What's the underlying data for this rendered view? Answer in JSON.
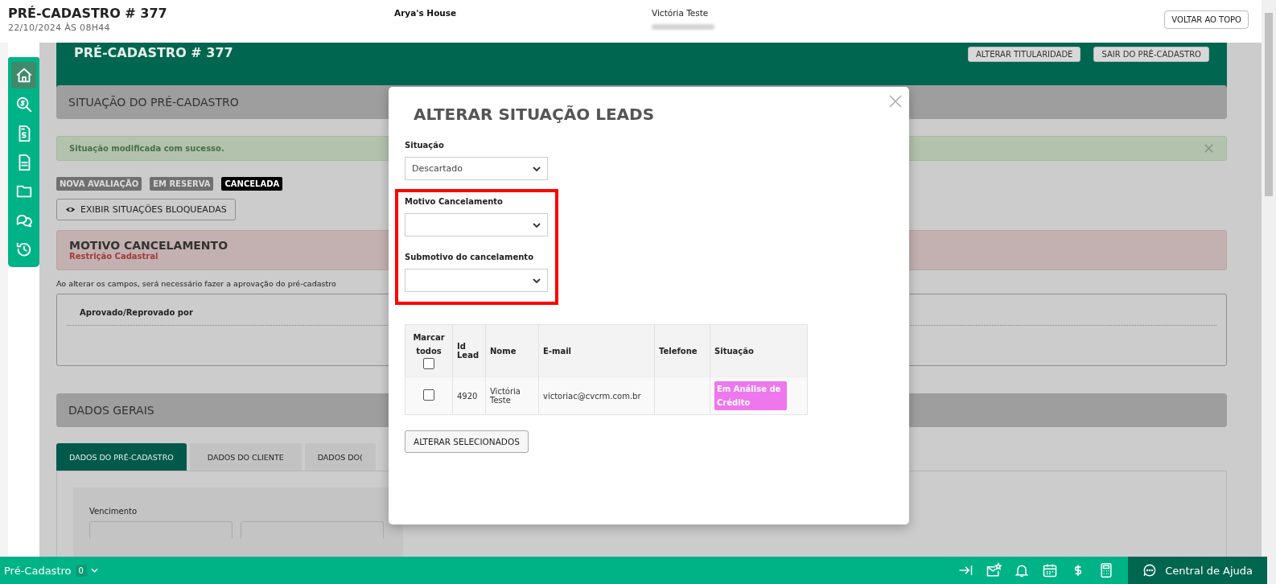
{
  "header": {
    "title": "PRÉ-CADASTRO # 377",
    "date": "22/10/2024 ÀS 08H44",
    "project": "Arya's House",
    "client": "Victória Teste",
    "top_button": "VOLTAR AO TOPO"
  },
  "banner": {
    "title": "PRÉ-CADASTRO # 377",
    "buttons": [
      "ALTERAR TITULARIDADE",
      "SAIR DO PRÉ-CADASTRO"
    ]
  },
  "sidebar": {
    "items": [
      {
        "selected": true
      },
      {
        "selected": false
      },
      {
        "selected": false
      },
      {
        "selected": false
      },
      {
        "selected": false
      },
      {
        "selected": false
      },
      {
        "selected": false
      }
    ]
  },
  "situation_section": {
    "title": "SITUAÇÃO DO PRÉ-CADASTRO",
    "alert": "Situação modificada com sucesso.",
    "tags": [
      {
        "label": "NOVA AVALIAÇÃO",
        "selected": false
      },
      {
        "label": "EM RESERVA",
        "selected": false
      },
      {
        "label": "CANCELADA",
        "selected": true
      }
    ],
    "toggle_button": "EXIBIR SITUAÇÕES BLOQUEADAS",
    "reason": {
      "title": "MOTIVO CANCELAMENTO",
      "value": "Restrição Cadastral"
    },
    "note": "Ao alterar os campos, será necessário fazer a aprovação do pré-cadastro",
    "approval_column": "Aprovado/Reprovado por"
  },
  "general_section": {
    "title": "DADOS GERAIS",
    "tabs": [
      {
        "label": "DADOS DO PRÉ-CADASTRO",
        "selected": true
      },
      {
        "label": "DADOS DO CLIENTE",
        "selected": false
      },
      {
        "label": "DADOS DO(",
        "selected": false
      }
    ],
    "field_label": "Vencimento"
  },
  "modal": {
    "title": "ALTERAR SITUAÇÃO LEADS",
    "fields": [
      {
        "label": "Situação",
        "value": "Descartado"
      }
    ],
    "highlighted_fields": [
      {
        "label": "Motivo Cancelamento"
      },
      {
        "label": "Submotivo do cancelamento"
      }
    ],
    "table": {
      "columns": [
        "Marcar todos",
        "Id Lead",
        "Nome",
        "E-mail",
        "Telefone",
        "Situação"
      ],
      "select_all_checked": false,
      "rows": [
        {
          "checked": false,
          "id": "4920",
          "name": "Victória Teste",
          "email": "victoriac@cvcrm.com.br",
          "status": "Em Análise de Crédito"
        }
      ]
    },
    "submit": "ALTERAR SELECIONADOS"
  },
  "bottom_bar": {
    "module": "Pré-Cadastro",
    "count": "0",
    "help": "Central de Ajuda"
  }
}
